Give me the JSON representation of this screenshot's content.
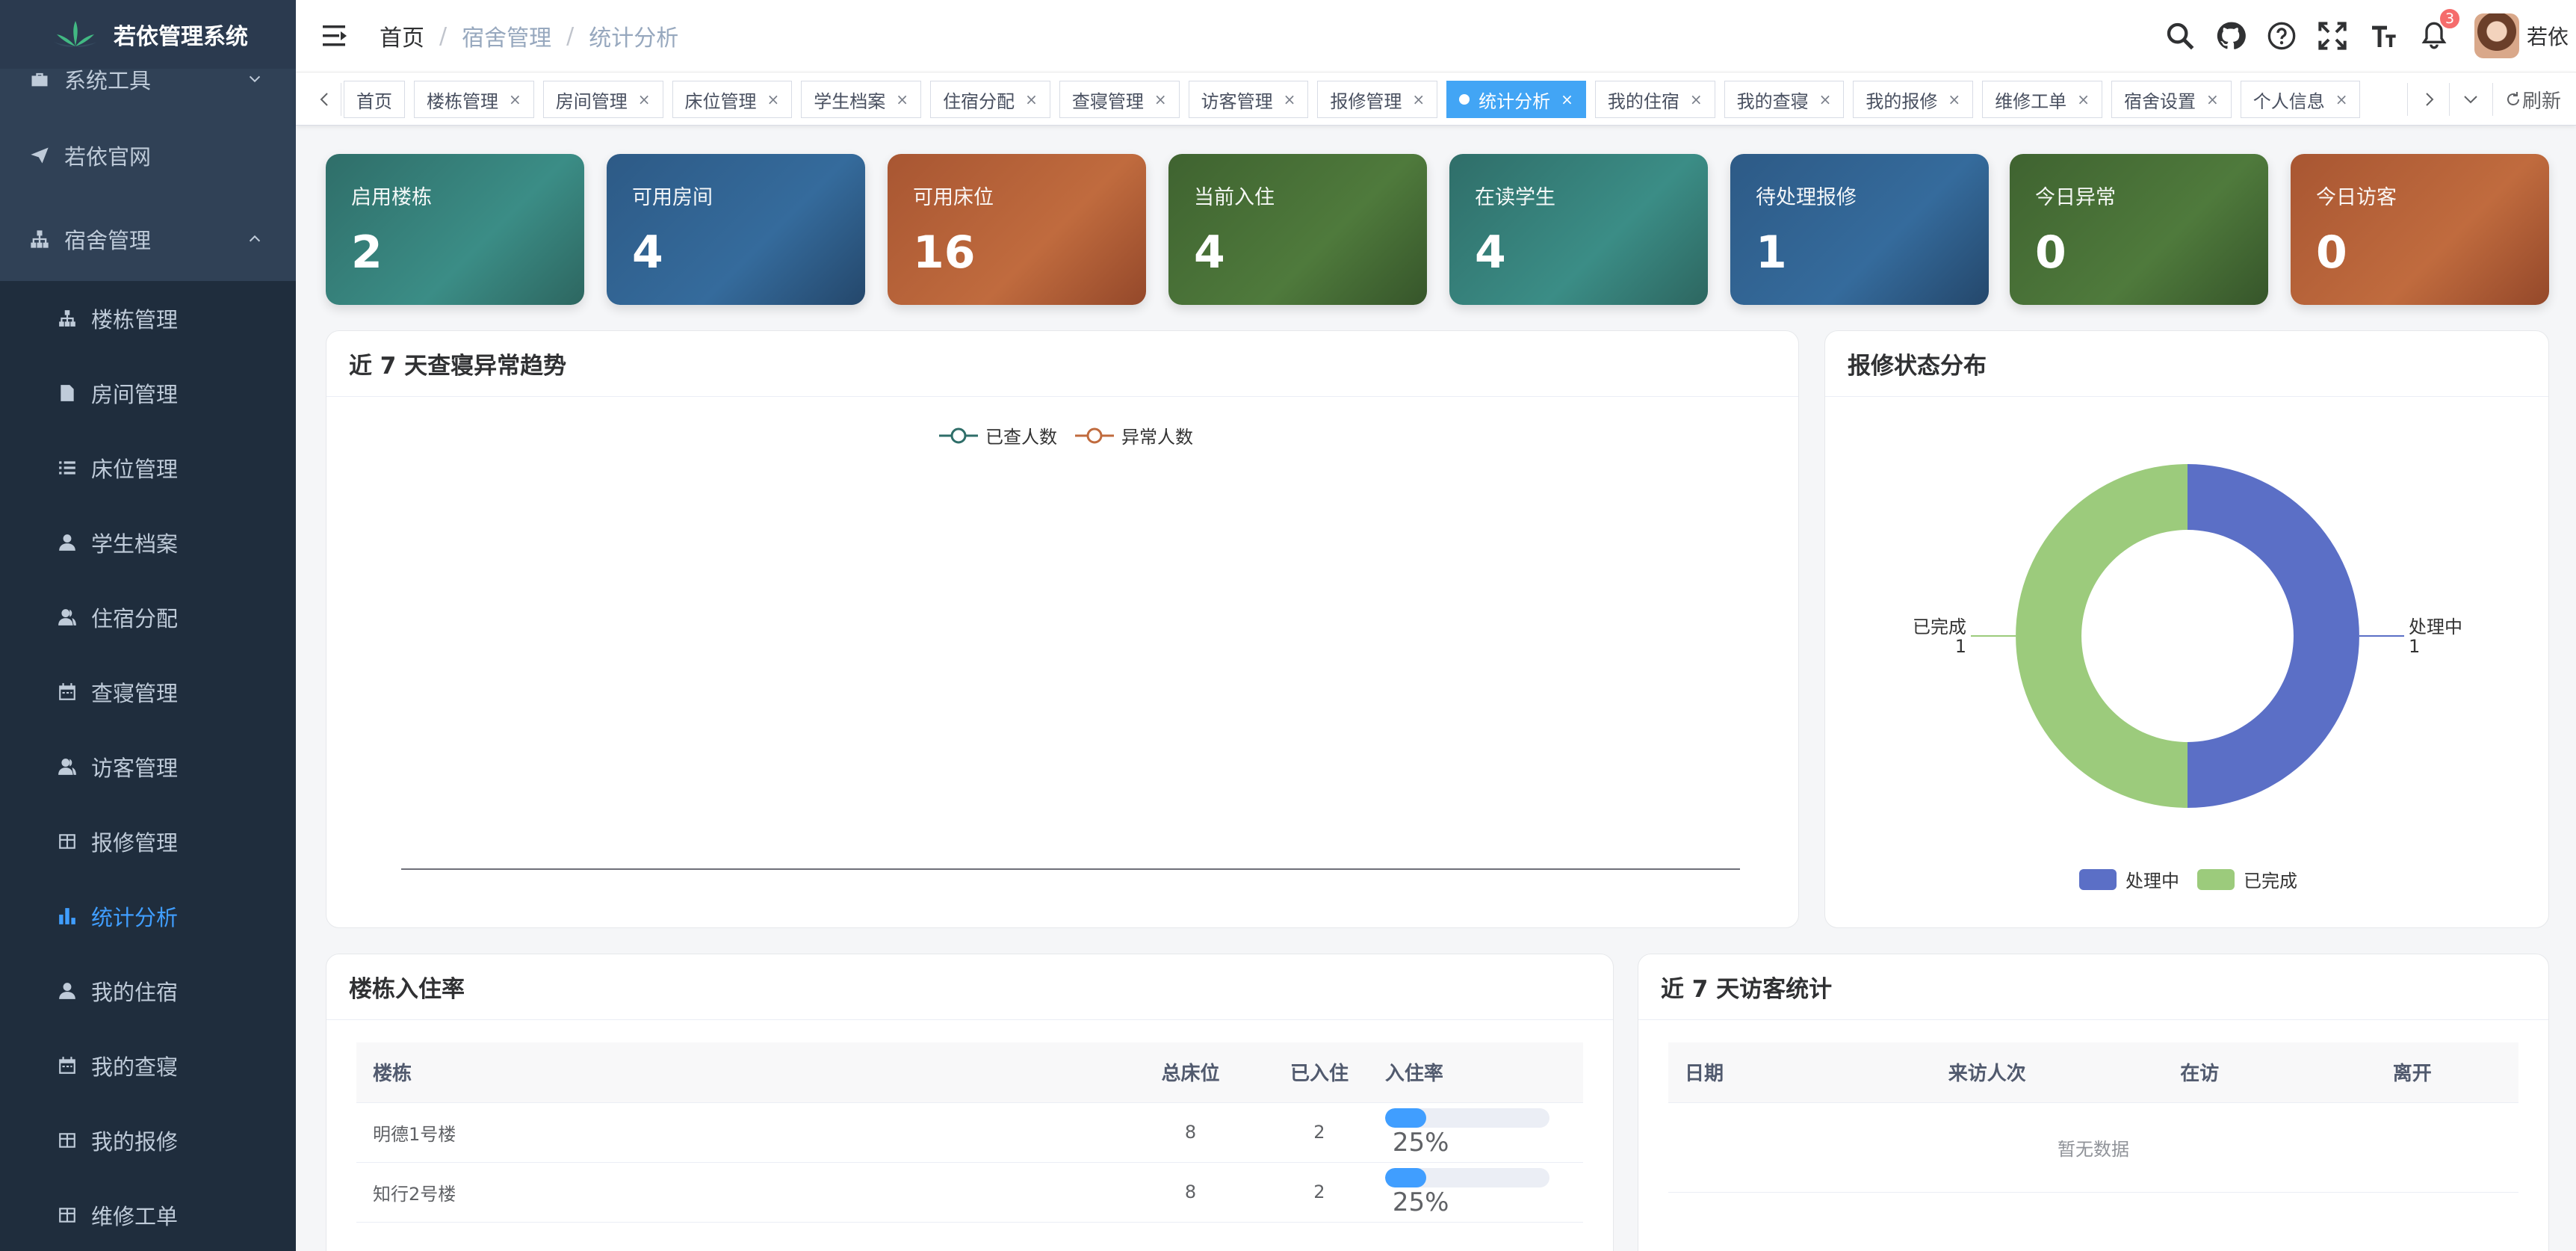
{
  "app": {
    "title": "若依管理系统"
  },
  "sidebar": {
    "items": [
      {
        "label": "系统工具",
        "icon": "toolbox-icon"
      },
      {
        "label": "若依官网",
        "icon": "send-icon"
      },
      {
        "label": "宿舍管理",
        "icon": "tree-icon",
        "expanded": true
      }
    ],
    "subitems": [
      {
        "label": "楼栋管理",
        "icon": "tree-icon"
      },
      {
        "label": "房间管理",
        "icon": "document-icon"
      },
      {
        "label": "床位管理",
        "icon": "list-icon"
      },
      {
        "label": "学生档案",
        "icon": "user-icon"
      },
      {
        "label": "住宿分配",
        "icon": "peoples-icon"
      },
      {
        "label": "查寝管理",
        "icon": "calendar-icon"
      },
      {
        "label": "访客管理",
        "icon": "peoples-icon"
      },
      {
        "label": "报修管理",
        "icon": "table-icon"
      },
      {
        "label": "统计分析",
        "icon": "chart-icon",
        "active": true
      },
      {
        "label": "我的住宿",
        "icon": "user-icon"
      },
      {
        "label": "我的查寝",
        "icon": "calendar-icon"
      },
      {
        "label": "我的报修",
        "icon": "table-icon"
      },
      {
        "label": "维修工单",
        "icon": "table-icon"
      }
    ]
  },
  "navbar": {
    "breadcrumb": [
      "首页",
      "宿舍管理",
      "统计分析"
    ],
    "notification_count": "3",
    "username": "若依"
  },
  "tags": {
    "items": [
      "首页",
      "楼栋管理",
      "房间管理",
      "床位管理",
      "学生档案",
      "住宿分配",
      "查寝管理",
      "访客管理",
      "报修管理",
      "统计分析",
      "我的住宿",
      "我的查寝",
      "我的报修",
      "维修工单",
      "宿舍设置",
      "个人信息"
    ],
    "active_index": 9,
    "refresh_label": "刷新"
  },
  "stats": [
    {
      "label": "启用楼栋",
      "value": "2"
    },
    {
      "label": "可用房间",
      "value": "4"
    },
    {
      "label": "可用床位",
      "value": "16"
    },
    {
      "label": "当前入住",
      "value": "4"
    },
    {
      "label": "在读学生",
      "value": "4"
    },
    {
      "label": "待处理报修",
      "value": "1"
    },
    {
      "label": "今日异常",
      "value": "0"
    },
    {
      "label": "今日访客",
      "value": "0"
    }
  ],
  "colors": {
    "teal": "#3b8d86",
    "blue": "#356b9c",
    "orange": "#c06b3e",
    "green": "#4f7a3c",
    "accent": "#409eff",
    "pie_processing": "#5b6fc6",
    "pie_done": "#9ccb7c"
  },
  "trend": {
    "title": "近 7 天查寝异常趋势",
    "legend": [
      "已查人数",
      "异常人数"
    ]
  },
  "repair": {
    "title": "报修状态分布",
    "legend": [
      "处理中",
      "已完成"
    ]
  },
  "chart_data": [
    {
      "type": "line",
      "title": "近 7 天查寝异常趋势",
      "x": [],
      "series": [
        {
          "name": "已查人数",
          "values": []
        },
        {
          "name": "异常人数",
          "values": []
        }
      ],
      "legend": "top-center"
    },
    {
      "type": "pie",
      "title": "报修状态分布",
      "categories": [
        "处理中",
        "已完成"
      ],
      "values": [
        1,
        1
      ],
      "legend": "bottom-center"
    }
  ],
  "occupancy": {
    "title": "楼栋入住率",
    "headers": [
      "楼栋",
      "总床位",
      "已入住",
      "入住率"
    ],
    "rows": [
      {
        "building": "明德1号楼",
        "total": "8",
        "occupied": "2",
        "rate_label": "25%",
        "rate": 0.25
      },
      {
        "building": "知行2号楼",
        "total": "8",
        "occupied": "2",
        "rate_label": "25%",
        "rate": 0.25
      }
    ]
  },
  "visitors": {
    "title": "近 7 天访客统计",
    "headers": [
      "日期",
      "来访人次",
      "在访",
      "离开"
    ],
    "empty_text": "暂无数据"
  }
}
